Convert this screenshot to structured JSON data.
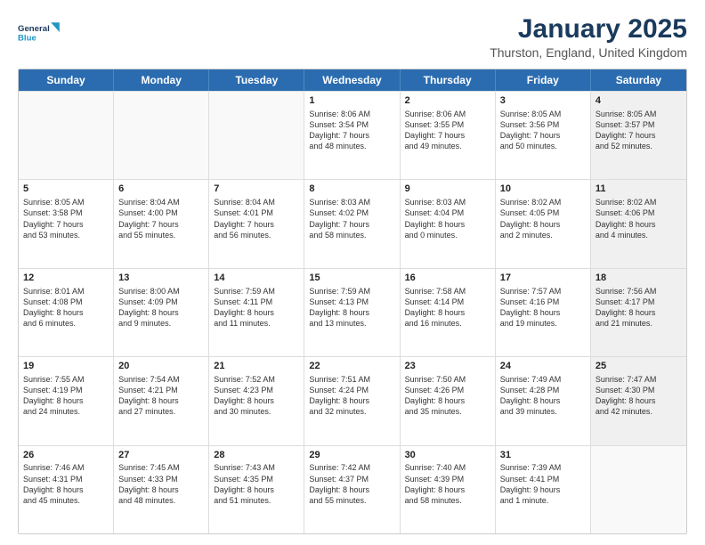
{
  "header": {
    "logo_line1": "General",
    "logo_line2": "Blue",
    "title": "January 2025",
    "subtitle": "Thurston, England, United Kingdom"
  },
  "weekdays": [
    "Sunday",
    "Monday",
    "Tuesday",
    "Wednesday",
    "Thursday",
    "Friday",
    "Saturday"
  ],
  "weeks": [
    [
      {
        "day": "",
        "text": "",
        "empty": true
      },
      {
        "day": "",
        "text": "",
        "empty": true
      },
      {
        "day": "",
        "text": "",
        "empty": true
      },
      {
        "day": "1",
        "text": "Sunrise: 8:06 AM\nSunset: 3:54 PM\nDaylight: 7 hours\nand 48 minutes."
      },
      {
        "day": "2",
        "text": "Sunrise: 8:06 AM\nSunset: 3:55 PM\nDaylight: 7 hours\nand 49 minutes."
      },
      {
        "day": "3",
        "text": "Sunrise: 8:05 AM\nSunset: 3:56 PM\nDaylight: 7 hours\nand 50 minutes."
      },
      {
        "day": "4",
        "text": "Sunrise: 8:05 AM\nSunset: 3:57 PM\nDaylight: 7 hours\nand 52 minutes.",
        "shaded": true
      }
    ],
    [
      {
        "day": "5",
        "text": "Sunrise: 8:05 AM\nSunset: 3:58 PM\nDaylight: 7 hours\nand 53 minutes."
      },
      {
        "day": "6",
        "text": "Sunrise: 8:04 AM\nSunset: 4:00 PM\nDaylight: 7 hours\nand 55 minutes."
      },
      {
        "day": "7",
        "text": "Sunrise: 8:04 AM\nSunset: 4:01 PM\nDaylight: 7 hours\nand 56 minutes."
      },
      {
        "day": "8",
        "text": "Sunrise: 8:03 AM\nSunset: 4:02 PM\nDaylight: 7 hours\nand 58 minutes."
      },
      {
        "day": "9",
        "text": "Sunrise: 8:03 AM\nSunset: 4:04 PM\nDaylight: 8 hours\nand 0 minutes."
      },
      {
        "day": "10",
        "text": "Sunrise: 8:02 AM\nSunset: 4:05 PM\nDaylight: 8 hours\nand 2 minutes."
      },
      {
        "day": "11",
        "text": "Sunrise: 8:02 AM\nSunset: 4:06 PM\nDaylight: 8 hours\nand 4 minutes.",
        "shaded": true
      }
    ],
    [
      {
        "day": "12",
        "text": "Sunrise: 8:01 AM\nSunset: 4:08 PM\nDaylight: 8 hours\nand 6 minutes."
      },
      {
        "day": "13",
        "text": "Sunrise: 8:00 AM\nSunset: 4:09 PM\nDaylight: 8 hours\nand 9 minutes."
      },
      {
        "day": "14",
        "text": "Sunrise: 7:59 AM\nSunset: 4:11 PM\nDaylight: 8 hours\nand 11 minutes."
      },
      {
        "day": "15",
        "text": "Sunrise: 7:59 AM\nSunset: 4:13 PM\nDaylight: 8 hours\nand 13 minutes."
      },
      {
        "day": "16",
        "text": "Sunrise: 7:58 AM\nSunset: 4:14 PM\nDaylight: 8 hours\nand 16 minutes."
      },
      {
        "day": "17",
        "text": "Sunrise: 7:57 AM\nSunset: 4:16 PM\nDaylight: 8 hours\nand 19 minutes."
      },
      {
        "day": "18",
        "text": "Sunrise: 7:56 AM\nSunset: 4:17 PM\nDaylight: 8 hours\nand 21 minutes.",
        "shaded": true
      }
    ],
    [
      {
        "day": "19",
        "text": "Sunrise: 7:55 AM\nSunset: 4:19 PM\nDaylight: 8 hours\nand 24 minutes."
      },
      {
        "day": "20",
        "text": "Sunrise: 7:54 AM\nSunset: 4:21 PM\nDaylight: 8 hours\nand 27 minutes."
      },
      {
        "day": "21",
        "text": "Sunrise: 7:52 AM\nSunset: 4:23 PM\nDaylight: 8 hours\nand 30 minutes."
      },
      {
        "day": "22",
        "text": "Sunrise: 7:51 AM\nSunset: 4:24 PM\nDaylight: 8 hours\nand 32 minutes."
      },
      {
        "day": "23",
        "text": "Sunrise: 7:50 AM\nSunset: 4:26 PM\nDaylight: 8 hours\nand 35 minutes."
      },
      {
        "day": "24",
        "text": "Sunrise: 7:49 AM\nSunset: 4:28 PM\nDaylight: 8 hours\nand 39 minutes."
      },
      {
        "day": "25",
        "text": "Sunrise: 7:47 AM\nSunset: 4:30 PM\nDaylight: 8 hours\nand 42 minutes.",
        "shaded": true
      }
    ],
    [
      {
        "day": "26",
        "text": "Sunrise: 7:46 AM\nSunset: 4:31 PM\nDaylight: 8 hours\nand 45 minutes."
      },
      {
        "day": "27",
        "text": "Sunrise: 7:45 AM\nSunset: 4:33 PM\nDaylight: 8 hours\nand 48 minutes."
      },
      {
        "day": "28",
        "text": "Sunrise: 7:43 AM\nSunset: 4:35 PM\nDaylight: 8 hours\nand 51 minutes."
      },
      {
        "day": "29",
        "text": "Sunrise: 7:42 AM\nSunset: 4:37 PM\nDaylight: 8 hours\nand 55 minutes."
      },
      {
        "day": "30",
        "text": "Sunrise: 7:40 AM\nSunset: 4:39 PM\nDaylight: 8 hours\nand 58 minutes."
      },
      {
        "day": "31",
        "text": "Sunrise: 7:39 AM\nSunset: 4:41 PM\nDaylight: 9 hours\nand 1 minute."
      },
      {
        "day": "",
        "text": "",
        "empty": true,
        "shaded": true
      }
    ]
  ]
}
